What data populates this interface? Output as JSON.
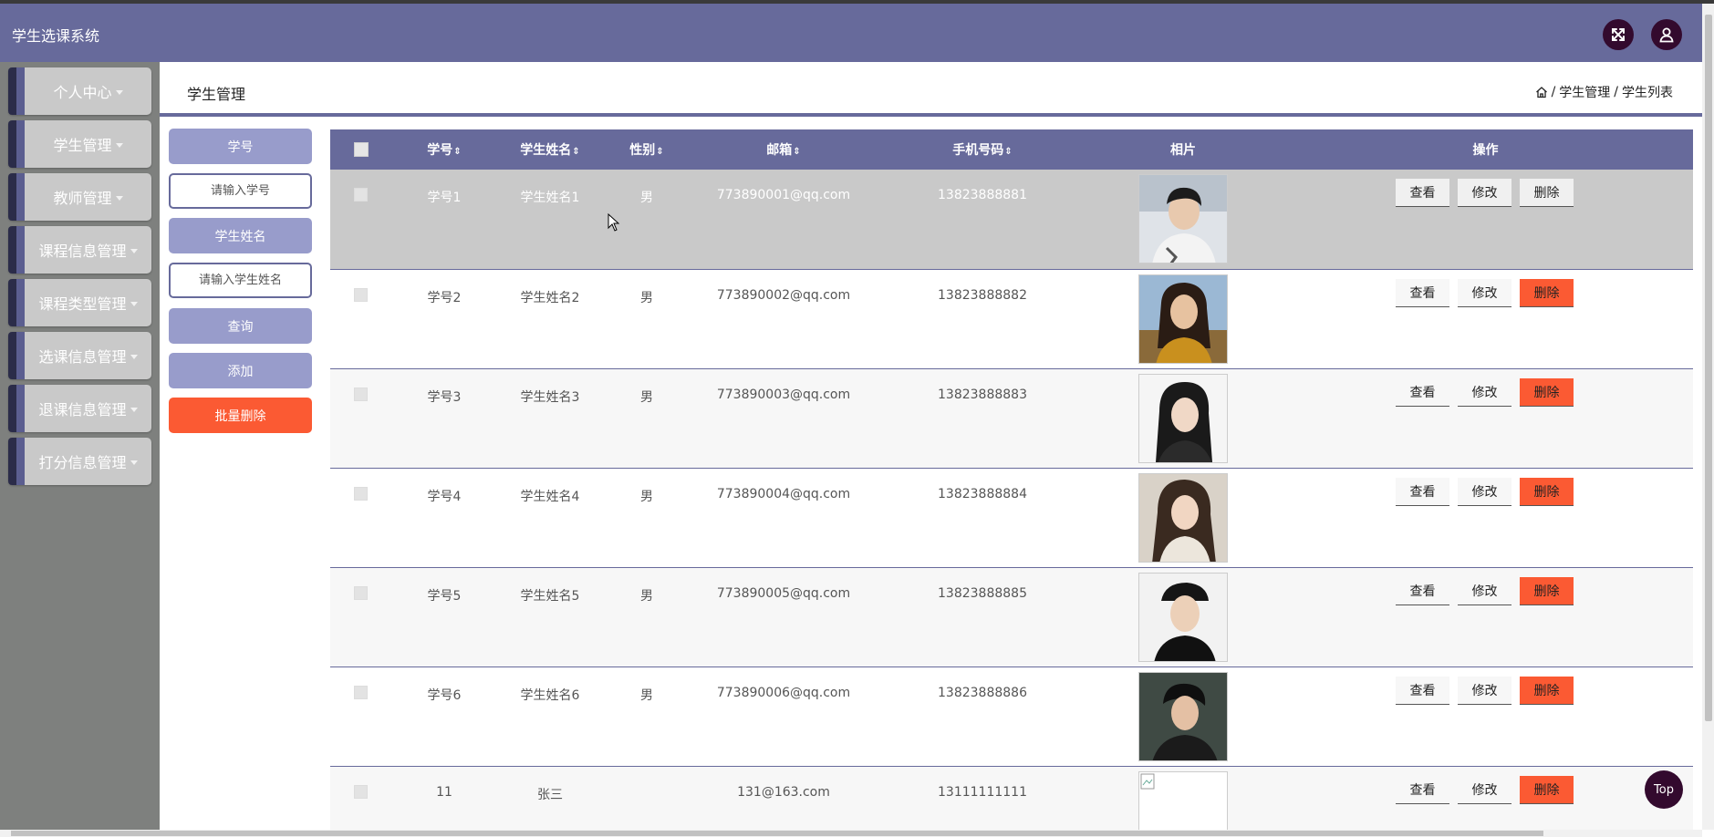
{
  "app": {
    "title": "学生选课系统"
  },
  "header": {
    "fullscreen_icon": "expand-arrows-icon",
    "user_icon": "user-icon"
  },
  "sidebar": {
    "items": [
      {
        "label": "个人中心"
      },
      {
        "label": "学生管理"
      },
      {
        "label": "教师管理"
      },
      {
        "label": "课程信息管理"
      },
      {
        "label": "课程类型管理"
      },
      {
        "label": "选课信息管理"
      },
      {
        "label": "退课信息管理"
      },
      {
        "label": "打分信息管理"
      }
    ]
  },
  "page": {
    "title": "学生管理",
    "breadcrumb": {
      "home_icon": "home-icon",
      "separator": "/",
      "level1": "学生管理",
      "level2": "学生列表"
    }
  },
  "search": {
    "field1_label": "学号",
    "field1_placeholder": "请输入学号",
    "field2_label": "学生姓名",
    "field2_placeholder": "请输入学生姓名",
    "query_button": "查询",
    "add_button": "添加",
    "batch_delete_button": "批量删除"
  },
  "table": {
    "columns": [
      "学号",
      "学生姓名",
      "性别",
      "邮箱",
      "手机号码",
      "相片",
      "操作"
    ],
    "sort_glyph": "⇕",
    "actions": {
      "view": "查看",
      "edit": "修改",
      "delete": "删除"
    },
    "rows": [
      {
        "id": "学号1",
        "name": "学生姓名1",
        "gender": "男",
        "email": "773890001@qq.com",
        "phone": "13823888881",
        "photo": "portrait-male-1",
        "selected": true
      },
      {
        "id": "学号2",
        "name": "学生姓名2",
        "gender": "男",
        "email": "773890002@qq.com",
        "phone": "13823888882",
        "photo": "portrait-female-1"
      },
      {
        "id": "学号3",
        "name": "学生姓名3",
        "gender": "男",
        "email": "773890003@qq.com",
        "phone": "13823888883",
        "photo": "portrait-female-2"
      },
      {
        "id": "学号4",
        "name": "学生姓名4",
        "gender": "男",
        "email": "773890004@qq.com",
        "phone": "13823888884",
        "photo": "portrait-female-3"
      },
      {
        "id": "学号5",
        "name": "学生姓名5",
        "gender": "男",
        "email": "773890005@qq.com",
        "phone": "13823888885",
        "photo": "portrait-male-2"
      },
      {
        "id": "学号6",
        "name": "学生姓名6",
        "gender": "男",
        "email": "773890006@qq.com",
        "phone": "13823888886",
        "photo": "portrait-male-3"
      },
      {
        "id": "11",
        "name": "张三",
        "gender": "",
        "email": "131@163.com",
        "phone": "13111111111",
        "photo": "broken-image"
      }
    ]
  },
  "back_to_top": "Top",
  "colors": {
    "primary": "#676a9b",
    "light_primary": "#989ccb",
    "danger": "#fb5a33",
    "dark_accent": "#330a2e",
    "sidebar_bg": "#7e807e",
    "sidebar_item": "#c9c9c9"
  }
}
